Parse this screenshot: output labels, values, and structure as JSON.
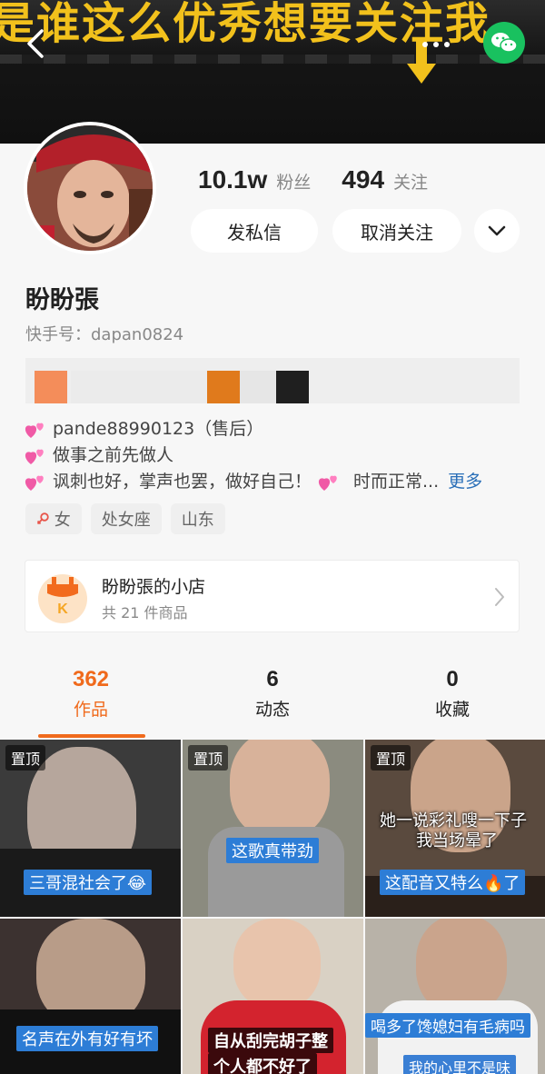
{
  "banner": {
    "headline": "是谁这么优秀想要关注我"
  },
  "profile": {
    "name": "盼盼張",
    "kuaishou_id": "快手号：dapan0824",
    "followers_num": "10.1w",
    "followers_label": "粉丝",
    "following_num": "494",
    "following_label": "关注",
    "message_button": "发私信",
    "unfollow_button": "取消关注"
  },
  "bio": {
    "line1": "pande88990123（售后）",
    "line2": "做事之前先做人",
    "line3a": "讽刺也好，掌声也罢，做好自己！",
    "line3b": "时而正常...",
    "more_link": "更多"
  },
  "tags": {
    "gender": "女",
    "zodiac": "处女座",
    "region": "山东"
  },
  "shop": {
    "title": "盼盼張的小店",
    "subtitle": "共 21 件商品"
  },
  "tabs": [
    {
      "count": "362",
      "label": "作品"
    },
    {
      "count": "6",
      "label": "动态"
    },
    {
      "count": "0",
      "label": "收藏"
    }
  ],
  "videos": {
    "pinned_label": "置顶",
    "v1_caption": "三哥混社会了😂",
    "v2_caption": "这歌真带劲",
    "v3_caption_top1": "她一说彩礼嗖一下子",
    "v3_caption_top2": "我当场晕了",
    "v3_caption_bottom": "这配音又特么🔥了",
    "v4_caption": "名声在外有好有坏",
    "v5_caption1": "自从刮完胡子整",
    "v5_caption2": "个人都不好了",
    "v6_caption1": "喝多了馋媳妇有毛病吗",
    "v6_caption2": "我的心里不是味"
  },
  "colors": {
    "accent": "#f06a1c",
    "link": "#2a6fb8",
    "wechat": "#19c15f",
    "caption_blue": "#2d7dd6"
  }
}
